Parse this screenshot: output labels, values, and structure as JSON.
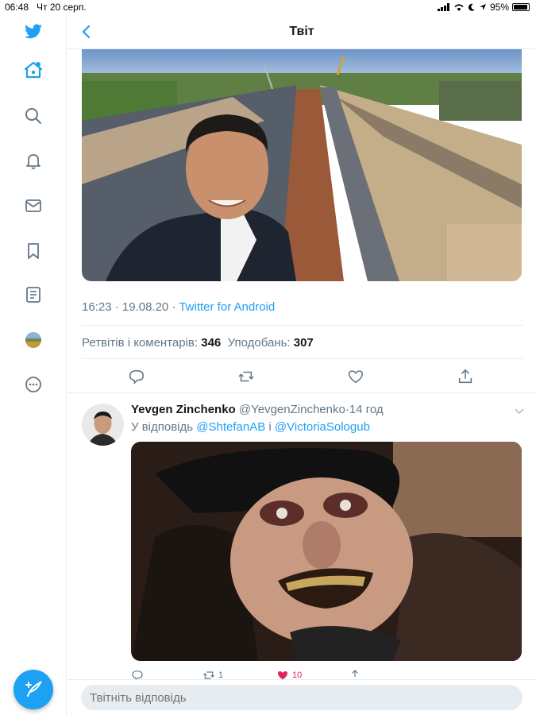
{
  "status_bar": {
    "time": "06:48",
    "date": "Чт 20 серп.",
    "battery": "95%"
  },
  "header": {
    "title": "Твіт"
  },
  "tweet": {
    "time": "16:23",
    "date": "19.08.20",
    "source": "Twitter for Android",
    "retweets_label": "Ретвітів і коментарів:",
    "retweets_count": "346",
    "likes_label": "Уподобань:",
    "likes_count": "307"
  },
  "reply": {
    "name": "Yevgen Zinchenko",
    "handle": "@YevgenZinchenko",
    "time": "14 год",
    "replying_prefix": "У відповідь",
    "mention1": "@ShtefanAB",
    "conj": "і",
    "mention2": "@VictoriaSologub",
    "retweet_count": "1",
    "like_count": "10"
  },
  "compose_reply": {
    "placeholder": "Твітніть відповідь"
  },
  "colors": {
    "accent": "#1da1f2",
    "like": "#e0245e",
    "muted": "#657786",
    "border": "#e6ecf0"
  }
}
